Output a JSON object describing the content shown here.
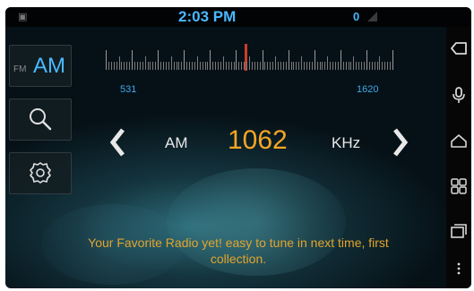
{
  "status_bar": {
    "time": "2:03 PM",
    "badge": "0",
    "left_icon": "sd-card-icon",
    "right_icon": "signal-icon"
  },
  "left_panel": {
    "band_button": {
      "secondary": "FM",
      "primary": "AM"
    },
    "search_icon": "search-icon",
    "settings_icon": "settings-icon"
  },
  "dial": {
    "min_label": "531",
    "max_label": "1620",
    "needle_color": "#d03a2a",
    "tuned_value": 1062,
    "range": [
      531,
      1620
    ]
  },
  "tuner": {
    "band": "AM",
    "frequency": "1062",
    "unit": "KHz",
    "prev_icon": "chevron-left-icon",
    "next_icon": "chevron-right-icon"
  },
  "message": "Your Favorite Radio yet! easy to tune in next time, first collection.",
  "right_bar": {
    "icons": [
      "back-icon",
      "microphone-icon",
      "home-icon",
      "apps-grid-icon",
      "recent-apps-icon",
      "more-icon"
    ]
  },
  "colors": {
    "accent_blue": "#4ab8ff",
    "frequency_orange": "#f5a623",
    "message_orange": "#e3a52c"
  }
}
